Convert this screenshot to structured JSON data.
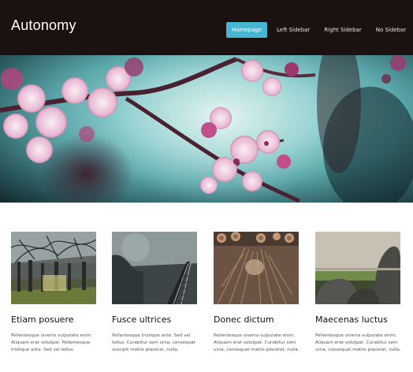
{
  "site": {
    "logo": "Autonomy"
  },
  "nav": {
    "items": [
      {
        "label": "Homepage",
        "active": true
      },
      {
        "label": "Left Sidebar",
        "active": false
      },
      {
        "label": "Right Sidebar",
        "active": false
      },
      {
        "label": "No Sidebar",
        "active": false
      }
    ]
  },
  "colors": {
    "header_bg": "#1b1110",
    "accent": "#47b6d1"
  },
  "features": [
    {
      "title": "Etiam posuere",
      "text": "Pellentesque viverra vulputate enim. Aliquam erat volutpat. Pellentesque tristique ante. Sed vel tellus.",
      "image": "trees-photo"
    },
    {
      "title": "Fusce ultrices",
      "text": "Pellentesque tristique ante. Sed vel tellus. Curabitur sem urna, consequat suscipit mattis placerat, nulla.",
      "image": "railroad-photo"
    },
    {
      "title": "Donec dictum",
      "text": "Pellentesque viverra vulputate enim. Aliquam erat volutpat. Curabitur sem urna, consequat mattis placerat, nulla.",
      "image": "logs-photo"
    },
    {
      "title": "Maecenas luctus",
      "text": "Pellentesque viverra vulputate enim. Aliquam erat volutpat. Curabitur sem urna, consequat mattis placerat, nulla.",
      "image": "rocks-photo"
    }
  ]
}
